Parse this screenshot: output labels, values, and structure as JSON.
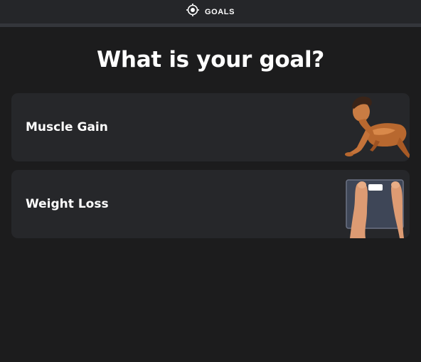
{
  "header": {
    "brand_label": "GOALS",
    "icon": "target-icon"
  },
  "progress": {
    "fraction": 0.0
  },
  "page": {
    "title": "What is your goal?"
  },
  "options": [
    {
      "label": "Muscle Gain",
      "image": "man-pushup-illustration"
    },
    {
      "label": "Weight Loss",
      "image": "feet-on-scale-illustration"
    }
  ],
  "colors": {
    "background": "#1c1c1d",
    "header": "#252629",
    "card": "#26272a",
    "text": "#ffffff"
  }
}
